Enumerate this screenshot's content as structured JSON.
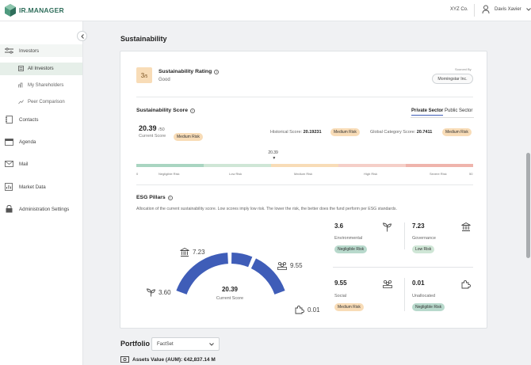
{
  "app": {
    "logo_text": "IR.MANAGER",
    "company": "XYZ Co.",
    "user_name": "Davis Xavier"
  },
  "sidebar": {
    "items": [
      {
        "label": "Investors",
        "icon": "investors-icon"
      },
      {
        "label": "All Investors",
        "icon": "list-icon",
        "active": true
      },
      {
        "label": "My Shareholders",
        "icon": "shareholders-icon"
      },
      {
        "label": "Peer Comparison",
        "icon": "comparison-icon"
      },
      {
        "label": "Contacts",
        "icon": "contacts-icon"
      },
      {
        "label": "Agenda",
        "icon": "calendar-icon"
      },
      {
        "label": "Mail",
        "icon": "mail-icon"
      },
      {
        "label": "Market Data",
        "icon": "chart-icon"
      },
      {
        "label": "Administration Settings",
        "icon": "lock-icon"
      }
    ]
  },
  "page": {
    "title": "Sustainability"
  },
  "rating": {
    "value": "3",
    "denominator": "/5",
    "title": "Sustainability Rating",
    "grade": "Good",
    "sourced_label": "Sourced By",
    "source": "Morningstar Inc."
  },
  "score": {
    "title": "Sustainability Score",
    "tabs": [
      "Private Sector",
      "Public Sector"
    ],
    "current_value": "20.39",
    "out_of": "/50",
    "current_label": "Current Score",
    "current_risk": "Medium Risk",
    "historical_label": "Historical Score:",
    "historical_value": "20.19231",
    "historical_risk": "Medium Risk",
    "global_label": "Global Category Score:",
    "global_value": "20.7411",
    "global_risk": "Medium Risk",
    "marker_value": "20.39",
    "marker_fraction": 0.4078,
    "scale_start": "0",
    "scale_end": "50",
    "bands": [
      {
        "label": "Negligible Risk",
        "color": "#a9d5c1"
      },
      {
        "label": "Low Risk",
        "color": "#cfe6d6"
      },
      {
        "label": "Medium Risk",
        "color": "#f8dcb7"
      },
      {
        "label": "High Risk",
        "color": "#f5cfc8"
      },
      {
        "label": "Severe Risk",
        "color": "#efb4ac"
      }
    ]
  },
  "esg": {
    "title": "ESG Pillars",
    "description": "Allocation of the current sustainability score. Low scores imply low risk. The lower the risk, the better does the fund perform per ESG standards.",
    "gauge_value": "20.39",
    "gauge_label": "Current Score",
    "gauge_color": "#3f5db8",
    "pillars": [
      {
        "name": "Environmental",
        "value": "3.6",
        "gauge_value": "3.60",
        "risk": "Negligible Risk",
        "icon": "plant-icon"
      },
      {
        "name": "Governance",
        "value": "7.23",
        "gauge_value": "7.23",
        "risk": "Low Risk",
        "icon": "bank-icon"
      },
      {
        "name": "Social",
        "value": "9.55",
        "gauge_value": "9.55",
        "risk": "Medium Risk",
        "icon": "people-icon"
      },
      {
        "name": "Unallocated",
        "value": "0.01",
        "gauge_value": "0.01",
        "risk": "Negligible Risk",
        "icon": "puzzle-icon"
      }
    ]
  },
  "portfolio": {
    "title": "Portfolio",
    "select_value": "FactSet",
    "aum": "Assets Value (AUM): €42,837.14 M"
  }
}
